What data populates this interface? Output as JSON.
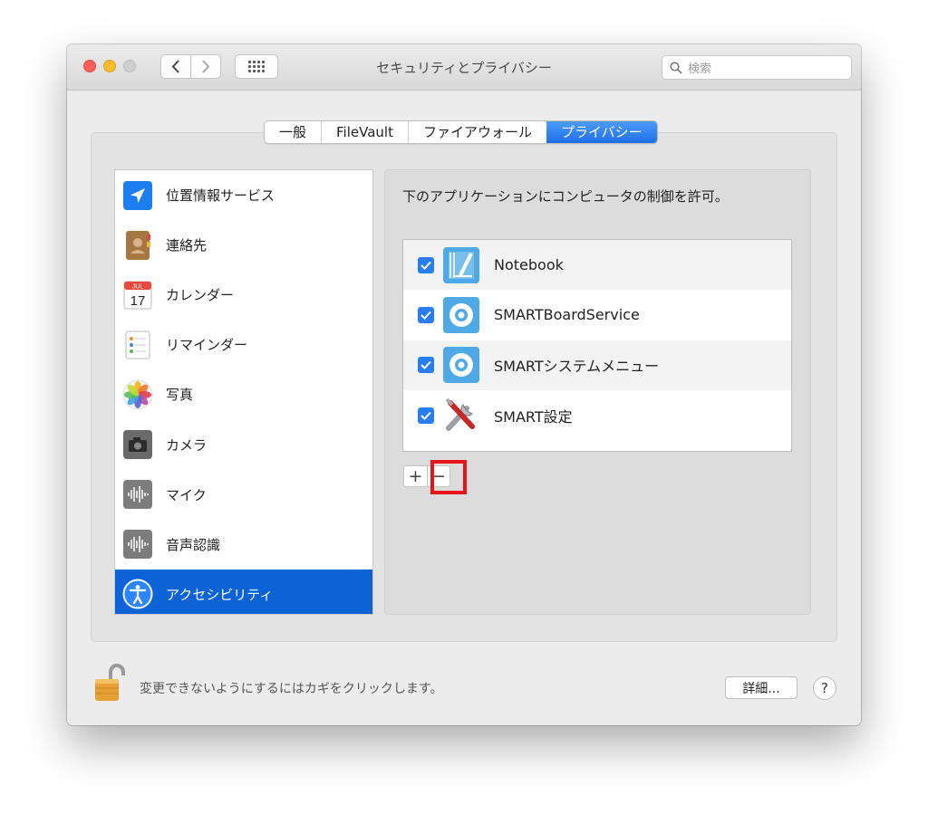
{
  "window": {
    "title": "セキュリティとプライバシー"
  },
  "search": {
    "placeholder": "検索"
  },
  "tabs": [
    {
      "label": "一般",
      "active": false
    },
    {
      "label": "FileVault",
      "active": false
    },
    {
      "label": "ファイアウォール",
      "active": false
    },
    {
      "label": "プライバシー",
      "active": true
    }
  ],
  "sidebar": {
    "items": [
      {
        "label": "位置情報サービス",
        "icon": "location-arrow-icon",
        "active": false
      },
      {
        "label": "連絡先",
        "icon": "contacts-book-icon",
        "active": false
      },
      {
        "label": "カレンダー",
        "icon": "calendar-icon",
        "active": false,
        "icon_month": "JUL",
        "icon_day": "17"
      },
      {
        "label": "リマインダー",
        "icon": "reminders-list-icon",
        "active": false
      },
      {
        "label": "写真",
        "icon": "photos-flower-icon",
        "active": false
      },
      {
        "label": "カメラ",
        "icon": "camera-icon",
        "active": false
      },
      {
        "label": "マイク",
        "icon": "microphone-waveform-icon",
        "active": false
      },
      {
        "label": "音声認識",
        "icon": "speech-recognition-waveform-icon",
        "active": false
      },
      {
        "label": "アクセシビリティ",
        "icon": "accessibility-icon",
        "active": true
      }
    ]
  },
  "main": {
    "description": "下のアプリケーションにコンピュータの制御を許可。",
    "apps": [
      {
        "name": "Notebook",
        "checked": true,
        "icon": "notebook-app-icon"
      },
      {
        "name": "SMARTBoardService",
        "checked": true,
        "icon": "smart-board-service-icon"
      },
      {
        "name": "SMARTシステムメニュー",
        "checked": true,
        "icon": "smart-system-menu-icon"
      },
      {
        "name": "SMART設定",
        "checked": true,
        "icon": "smart-settings-tools-icon"
      }
    ],
    "add_label": "+",
    "remove_label": "−"
  },
  "footer": {
    "lock_text": "変更できないようにするにはカギをクリックします。",
    "advanced_label": "詳細...",
    "help_label": "?"
  },
  "colors": {
    "accent": "#0b63d6",
    "checkbox": "#2a7cf2",
    "highlight": "#e8141b"
  }
}
